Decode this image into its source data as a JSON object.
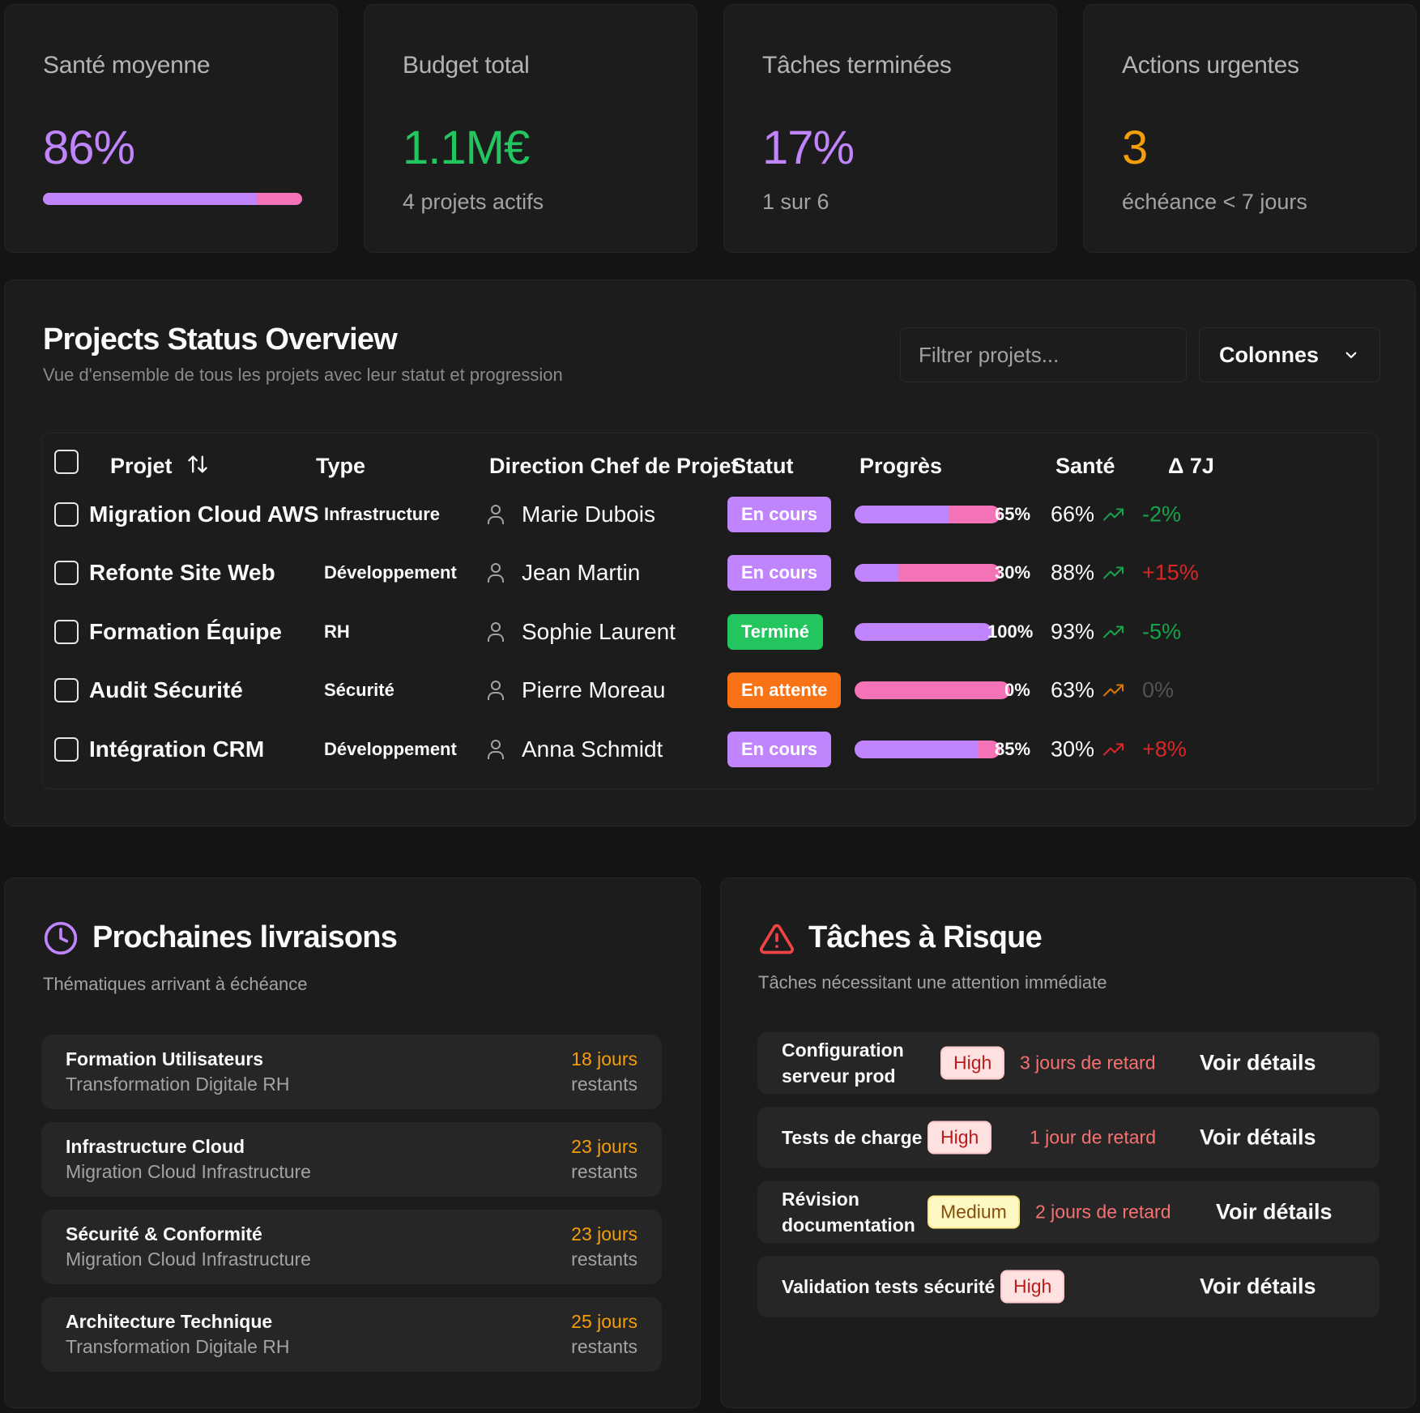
{
  "kpis": [
    {
      "label": "Santé moyenne",
      "value": "86%",
      "health_fraction": 0.86,
      "color": "#c084fc"
    },
    {
      "label": "Budget total",
      "value": "1.1M€",
      "sub": "4 projets actifs",
      "color": "#22c55e"
    },
    {
      "label": "Tâches terminées",
      "value": "17%",
      "sub": "1 sur 6",
      "color": "#c084fc"
    },
    {
      "label": "Actions urgentes",
      "value": "3",
      "sub": "échéance < 7 jours",
      "color": "#f59e0b"
    }
  ],
  "projects_overview": {
    "title": "Projects Status Overview",
    "subtitle": "Vue d'ensemble de tous les projets avec leur statut et progression",
    "filter_placeholder": "Filtrer projets...",
    "columns_label": "Colonnes",
    "headers": {
      "project": "Projet",
      "type": "Type",
      "owner": "Direction Chef de Projet",
      "status": "Statut",
      "progress": "Progrès",
      "health": "Santé",
      "delta": "Δ 7J"
    },
    "rows": [
      {
        "name": "Migration Cloud AWS",
        "type": "Infrastructure",
        "owner": "Marie Dubois",
        "status": "En cours",
        "status_color": "#c084fc",
        "progress": 65,
        "progress_label": "65%",
        "health": "66%",
        "trend_color": "#16a34a",
        "delta": "-2%",
        "delta_color": "#16a34a"
      },
      {
        "name": "Refonte Site Web",
        "type": "Développement",
        "owner": "Jean Martin",
        "status": "En cours",
        "status_color": "#c084fc",
        "progress": 30,
        "progress_label": "30%",
        "health": "88%",
        "trend_color": "#16a34a",
        "delta": "+15%",
        "delta_color": "#dc2626"
      },
      {
        "name": "Formation Équipe",
        "type": "RH",
        "owner": "Sophie Laurent",
        "status": "Terminé",
        "status_color": "#22c55e",
        "progress": 100,
        "progress_label": "100%",
        "health": "93%",
        "trend_color": "#16a34a",
        "delta": "-5%",
        "delta_color": "#16a34a"
      },
      {
        "name": "Audit Sécurité",
        "type": "Sécurité",
        "owner": "Pierre Moreau",
        "status": "En attente",
        "status_color": "#f97316",
        "progress": 0,
        "progress_label": "0%",
        "health": "63%",
        "trend_color": "#d97706",
        "delta": "0%",
        "delta_color": "#525252"
      },
      {
        "name": "Intégration CRM",
        "type": "Développement",
        "owner": "Anna Schmidt",
        "status": "En cours",
        "status_color": "#c084fc",
        "progress": 85,
        "progress_label": "85%",
        "health": "30%",
        "trend_color": "#dc2626",
        "delta": "+8%",
        "delta_color": "#dc2626"
      }
    ]
  },
  "deliveries": {
    "title": "Prochaines livraisons",
    "subtitle": "Thématiques arrivant à échéance",
    "icon": "clock-icon",
    "icon_color": "#c084fc",
    "items": [
      {
        "title": "Formation Utilisateurs",
        "sub": "Transformation Digitale RH",
        "days": "18 jours",
        "rest": "restants"
      },
      {
        "title": "Infrastructure Cloud",
        "sub": "Migration Cloud Infrastructure",
        "days": "23 jours",
        "rest": "restants"
      },
      {
        "title": "Sécurité & Conformité",
        "sub": "Migration Cloud Infrastructure",
        "days": "23 jours",
        "rest": "restants"
      },
      {
        "title": "Architecture Technique",
        "sub": "Transformation Digitale RH",
        "days": "25 jours",
        "rest": "restants"
      }
    ]
  },
  "risks": {
    "title": "Tâches à Risque",
    "subtitle": "Tâches nécessitant une attention immédiate",
    "icon": "warning-triangle-icon",
    "icon_color": "#ef4444",
    "details_label": "Voir détails",
    "items": [
      {
        "title": "Configuration serveur prod",
        "priority": "High",
        "late": "3 jours de retard"
      },
      {
        "title": "Tests de charge",
        "priority": "High",
        "late": "1 jour de retard"
      },
      {
        "title": "Révision documentation",
        "priority": "Medium",
        "late": "2 jours de retard"
      },
      {
        "title": "Validation tests sécurité",
        "priority": "High",
        "late": ""
      }
    ]
  }
}
